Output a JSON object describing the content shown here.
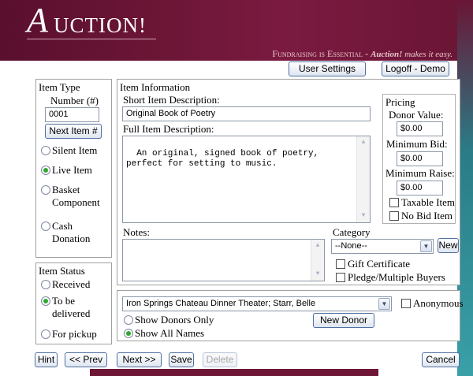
{
  "app": {
    "logo_initial": "A",
    "logo_rest": "UCTION!",
    "tagline_prefix": "Fundraising is Essential - ",
    "tagline_brand": "Auction!",
    "tagline_suffix": " makes it easy."
  },
  "header_buttons": {
    "user_settings": "User Settings",
    "logoff": "Logoff - Demo"
  },
  "item_type": {
    "title": "Item Type",
    "number_label": "Number (#)",
    "number_value": "0001",
    "next_item_button": "Next Item #",
    "options": [
      {
        "line1": "Silent Item",
        "line2": "",
        "selected": false
      },
      {
        "line1": "Live Item",
        "line2": "",
        "selected": true
      },
      {
        "line1": "Basket",
        "line2": "Component",
        "selected": false
      },
      {
        "line1": "Cash",
        "line2": "Donation",
        "selected": false
      }
    ]
  },
  "item_status": {
    "title": "Item Status",
    "options": [
      {
        "line1": "Received",
        "line2": "",
        "selected": false
      },
      {
        "line1": "To be",
        "line2": "delivered",
        "selected": true
      },
      {
        "line1": "For pickup",
        "line2": "",
        "selected": false
      }
    ]
  },
  "item_information": {
    "title": "Item Information",
    "short_label": "Short Item Description:",
    "short_value": "Original Book of Poetry",
    "full_label": "Full Item Description:",
    "full_value": "An original, signed book of poetry,\nperfect for setting to music.",
    "notes_label": "Notes:",
    "notes_value": ""
  },
  "pricing": {
    "title": "Pricing",
    "donor_value_label": "Donor Value:",
    "donor_value": "$0.00",
    "minimum_bid_label": "Minimum Bid:",
    "minimum_bid": "$0.00",
    "minimum_raise_label": "Minimum Raise:",
    "minimum_raise": "$0.00",
    "taxable_label": "Taxable Item",
    "no_bid_label": "No Bid Item"
  },
  "category": {
    "label": "Category",
    "selected": "--None--",
    "new_button": "New",
    "gift_certificate_label": "Gift Certificate",
    "pledge_label": "Pledge/Multiple Buyers"
  },
  "donor": {
    "selected": "Iron Springs Chateau Dinner Theater; Starr, Belle",
    "anonymous_label": "Anonymous",
    "show_donors_only": "Show Donors Only",
    "show_all_names": "Show All Names",
    "new_donor_button": "New Donor"
  },
  "footer_buttons": {
    "hint": "Hint",
    "prev": "<< Prev",
    "next": "Next >>",
    "save": "Save",
    "delete": "Delete",
    "cancel": "Cancel"
  },
  "colors": {
    "header": "#6d1636",
    "accent_border": "#4f6fa3",
    "radio_selected": "#2fa72f"
  }
}
